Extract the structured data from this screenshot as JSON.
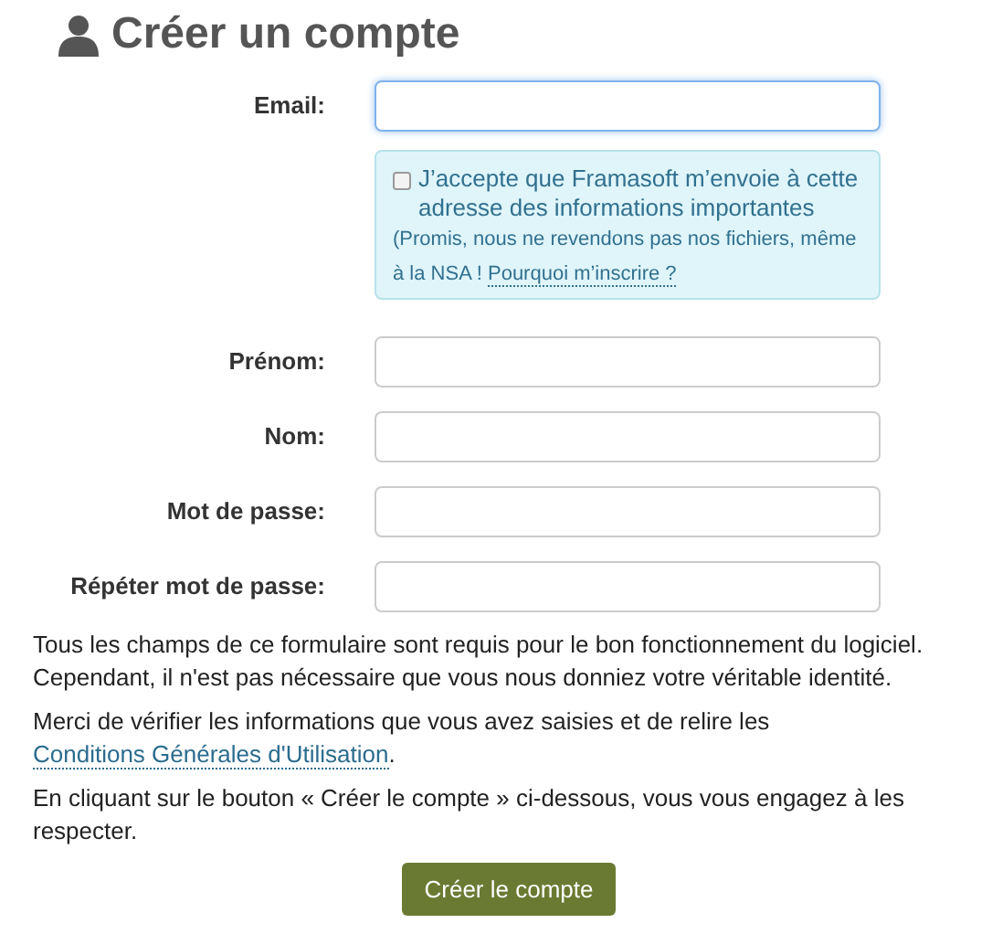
{
  "title": "Créer un compte",
  "fields": [
    {
      "label": "Email:",
      "focused": true
    }
  ],
  "newsletter": {
    "checked": false,
    "text": "J’accepte que Framasoft m’envoie à cette adresse des informations importantes",
    "note": "(Promis, nous ne revendons pas nos fichiers, même à la NSA !",
    "link": "Pourquoi m’inscrire ?"
  },
  "more_fields": [
    {
      "label": "Prénom:",
      "focused": false
    },
    {
      "label": "Nom:",
      "focused": false
    },
    {
      "label": "Mot de passe:",
      "focused": false
    },
    {
      "label": "Répéter mot de passe:",
      "focused": false
    }
  ],
  "paragraphs": [
    {
      "parts": [
        {
          "kind": "text",
          "text": "Tous les champs de ce formulaire sont requis pour le bon fonctionnement du logiciel. Cependant, il n'est pas nécessaire que vous nous donniez votre véritable identité."
        }
      ]
    },
    {
      "parts": [
        {
          "kind": "text",
          "text": "Merci de vérifier les informations que vous avez saisies et de relire les "
        },
        {
          "kind": "link",
          "text": "Conditions Générales d'Utilisation"
        },
        {
          "kind": "text",
          "text": "."
        }
      ]
    },
    {
      "parts": [
        {
          "kind": "text",
          "text": "En cliquant sur le bouton « Créer le compte » ci-dessous, vous vous engagez à les respecter."
        }
      ]
    }
  ],
  "submit_button": "Créer le compte"
}
